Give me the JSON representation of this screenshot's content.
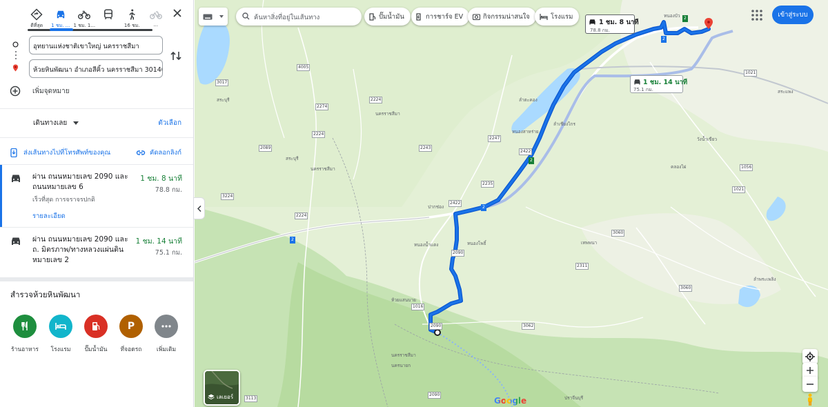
{
  "travel_modes": [
    {
      "icon": "best-route-icon",
      "label": "ดีที่สุด"
    },
    {
      "icon": "car-icon",
      "label": "1 ชม. ..."
    },
    {
      "icon": "motorcycle-icon",
      "label": "1 ชม. 1..."
    },
    {
      "icon": "transit-icon",
      "label": ""
    },
    {
      "icon": "walking-icon",
      "label": "16 ชม."
    },
    {
      "icon": "bicycle-icon",
      "label": "..."
    }
  ],
  "waypoints": {
    "start": "อุทยานแห่งชาติเขาใหญ่ นครราชสีมา",
    "destination": "ห้วยหินพัฒนา อำเภอสีคิ้ว นครราชสีมา 30140",
    "add_destination": "เพิ่มจุดหมาย"
  },
  "controls": {
    "leave_now": "เดินทางเลย",
    "options": "ตัวเลือก",
    "send_to_phone": "ส่งเส้นทางไปที่โทรศัพท์ของคุณ",
    "copy_link": "คัดลอกลิงก์"
  },
  "routes": [
    {
      "name": "ผ่าน ถนนหมายเลข 2090 และ ถนนหมายเลข 6",
      "time": "1 ชม. 8 นาที",
      "distance": "78.8 กม.",
      "subtitle": "เร็วที่สุด การจราจรปกติ",
      "details": "รายละเอียด"
    },
    {
      "name": "ผ่าน ถนนหมายเลข 2090 และ ถ. มิตรภาพ/ทางหลวงแผ่นดินหมายเลข 2",
      "time": "1 ชม. 14 นาที",
      "distance": "75.1 กม."
    }
  ],
  "explore": {
    "title": "สำรวจห้วยหินพัฒนา",
    "categories": [
      {
        "label": "ร้านอาหาร",
        "icon": "restaurant-icon",
        "color": "#1e8e3e"
      },
      {
        "label": "โรงแรม",
        "icon": "hotel-icon",
        "color": "#12b5cb"
      },
      {
        "label": "ปั๊มน้ำมัน",
        "icon": "gas-station-icon",
        "color": "#d93025"
      },
      {
        "label": "ที่จอดรถ",
        "icon": "parking-icon",
        "color": "#b06000"
      },
      {
        "label": "เพิ่มเติม",
        "icon": "more-icon",
        "color": "#80868b"
      }
    ]
  },
  "map": {
    "search_placeholder": "ค้นหาสิ่งที่อยู่ในเส้นทาง",
    "chips": [
      "ปั๊มน้ำมัน",
      "การชาร์จ EV",
      "กิจกรรมน่าสนใจ",
      "โรงแรม"
    ],
    "sign_in": "เข้าสู่ระบบ",
    "layers_label": "เลเยอร์",
    "callout_primary": {
      "time": "1 ชม. 8 นาที",
      "distance": "78.8 กม."
    },
    "callout_alt": {
      "time": "1 ชม. 14 นาที",
      "distance": "75.1 กม."
    },
    "brand": "Google",
    "route_color": "#1a73e8",
    "places": [
      "สระบุรี",
      "สระบุรี",
      "นครราชสีมา",
      "นครราชสีมา",
      "ลำตะคอง",
      "หนองน้ำแดง",
      "ห้วยแสนบาย",
      "ปากช่อง",
      "หนองสาหร่าย",
      "นครราชสีมา",
      "นครนายก",
      "ปราจีนบุรี",
      "ลำพระเพลิง",
      "ลำเชียงไกร",
      "คลองไผ่",
      "สระแพง",
      "หนองโพธิ์",
      "เทพพนา",
      "วังน้ำเขียว",
      "หนองบัว"
    ],
    "route_numbers": [
      "4005",
      "3017",
      "2274",
      "2224",
      "2089",
      "2224",
      "3224",
      "2224",
      "2243",
      "2247",
      "2422",
      "2235",
      "2422",
      "2090",
      "3060",
      "2311",
      "2090",
      "3062",
      "1016",
      "1021",
      "1021",
      "1056",
      "3060",
      "2090",
      "3113"
    ],
    "highway_shields": [
      "2",
      "2",
      "2",
      "2",
      "2"
    ]
  }
}
